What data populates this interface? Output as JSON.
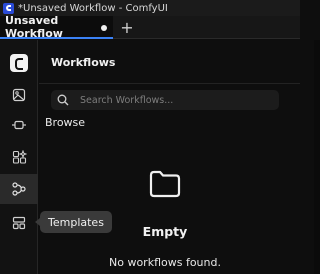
{
  "window": {
    "title": "*Unsaved Workflow - ComfyUI",
    "app_icon": "comfyui-logo-icon"
  },
  "tabs": [
    {
      "label": "Unsaved Workflow",
      "unsaved": true
    }
  ],
  "new_tab_label": "+",
  "rail": {
    "items": [
      {
        "name": "comfy-logo",
        "icon": "comfy-logo-icon"
      },
      {
        "name": "images",
        "icon": "image-icon"
      },
      {
        "name": "nodes",
        "icon": "node-icon"
      },
      {
        "name": "models",
        "icon": "sparkle-icon"
      },
      {
        "name": "workflows",
        "icon": "workflow-icon",
        "active": true
      },
      {
        "name": "templates",
        "icon": "templates-icon"
      }
    ]
  },
  "panel": {
    "title": "Workflows",
    "search_placeholder": "Search Workflows...",
    "browse_label": "Browse",
    "empty_title": "Empty",
    "empty_message": "No workflows found."
  },
  "tooltip": {
    "label": "Templates"
  }
}
